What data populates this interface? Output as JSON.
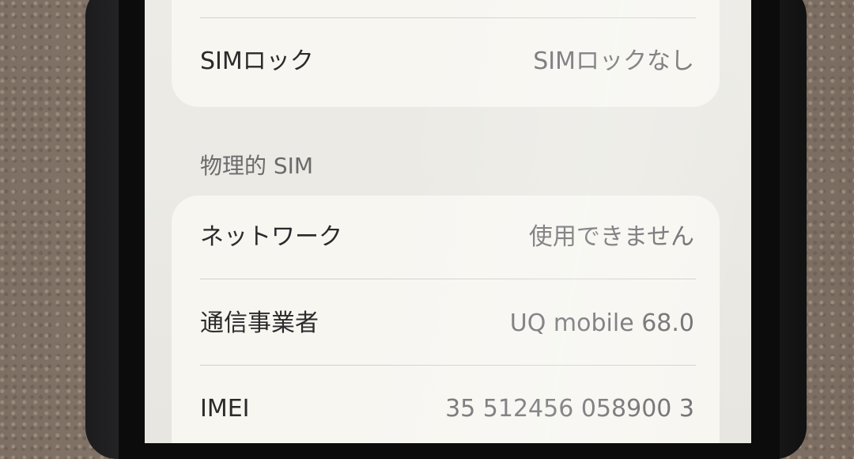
{
  "sim_lock": {
    "label": "SIMロック",
    "value": "SIMロックなし"
  },
  "physical_sim": {
    "title": "物理的 SIM",
    "rows": [
      {
        "label": "ネットワーク",
        "value": "使用できません"
      },
      {
        "label": "通信事業者",
        "value": "UQ mobile 68.0"
      },
      {
        "label": "IMEI",
        "value": "35 512456 058900 3"
      }
    ]
  }
}
